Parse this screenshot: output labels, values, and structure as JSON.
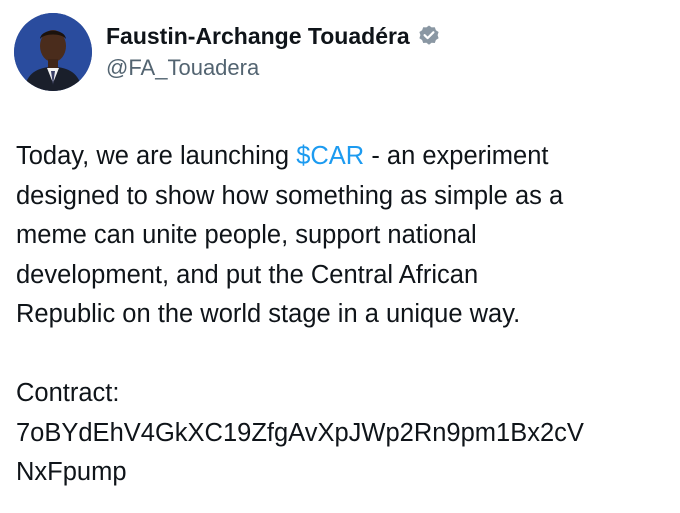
{
  "author": {
    "display_name": "Faustin-Archange Touadéra",
    "handle": "@FA_Touadera",
    "verified": true,
    "avatar_icon": "profile-photo"
  },
  "tweet": {
    "line1_before": "Today, we are launching ",
    "cashtag": "$CAR",
    "line1_after": " - an experiment",
    "line2": "designed to show how something as simple as a",
    "line3": "meme can unite people, support national",
    "line4": "development, and put the Central African",
    "line5": "Republic on the world stage in a unique way.",
    "contract_label": "Contract:",
    "contract_line1": "7oBYdEhV4GkXC19ZfgAvXpJWp2Rn9pm1Bx2cV",
    "contract_line2": "NxFpump"
  },
  "colors": {
    "text": "#0f1419",
    "secondary": "#536471",
    "accent": "#1d9bf0"
  }
}
